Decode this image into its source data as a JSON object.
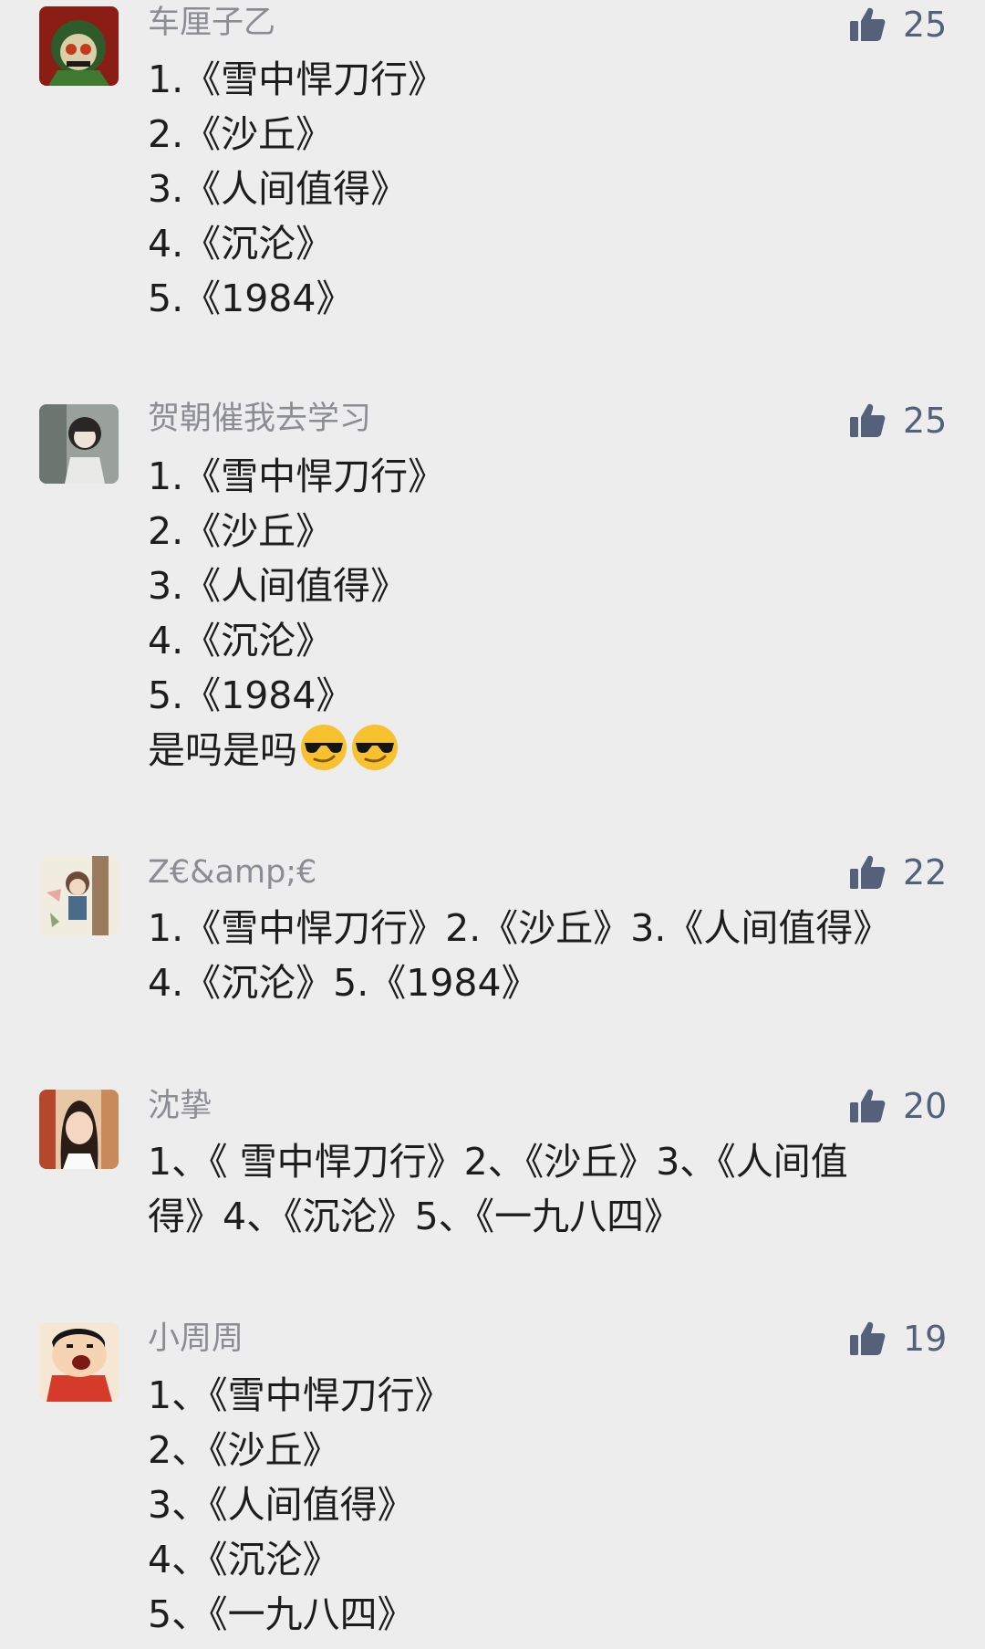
{
  "colors": {
    "background": "#ededee",
    "username": "#8b8d92",
    "like_blue": "#55617a",
    "text": "#1d1d1d"
  },
  "like_icon": "thumbs-up-icon",
  "comments": [
    {
      "username": "车厘子乙",
      "likes": "25",
      "lines": [
        "1.《雪中悍刀行》",
        "2.《沙丘》",
        "3.《人间值得》",
        "4.《沉沦》",
        "5.《1984》"
      ]
    },
    {
      "username": "贺朝催我去学习",
      "likes": "25",
      "lines": [
        "1.《雪中悍刀行》",
        "2.《沙丘》",
        "3.《人间值得》",
        "4.《沉沦》",
        "5.《1984》"
      ],
      "extra": "是吗是吗",
      "emoji": "cool-sunglasses-emoji"
    },
    {
      "username": "Z€&amp;€",
      "likes": "22",
      "paragraph": "1.《雪中悍刀行》2.《沙丘》3.《人间值得》4.《沉沦》5.《1984》"
    },
    {
      "username": "沈挚",
      "likes": "20",
      "paragraph": "1、《 雪中悍刀行》2、《沙丘》3、《人间值得》4、《沉沦》5、《一九八四》"
    },
    {
      "username": "小周周",
      "likes": "19",
      "lines": [
        "1、《雪中悍刀行》",
        "2、《沙丘》",
        "3、《人间值得》",
        "4、《沉沦》",
        "5、《一九八四》"
      ]
    }
  ]
}
